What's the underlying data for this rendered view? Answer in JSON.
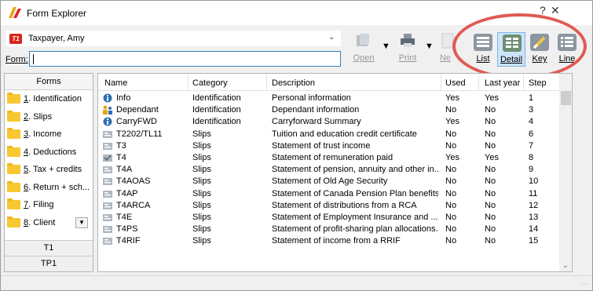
{
  "window": {
    "title": "Form Explorer",
    "help_glyph": "?",
    "close_glyph": "✕"
  },
  "taxpayer": {
    "name": "Taxpayer, Amy",
    "badge": "T1"
  },
  "form_field": {
    "label": "Form:",
    "value": ""
  },
  "toolbar": {
    "tools": [
      {
        "name": "open",
        "label": "Open",
        "icon": "open-icon",
        "enabled": false
      },
      {
        "name": "print",
        "label": "Print",
        "icon": "printer-icon",
        "enabled": false
      },
      {
        "name": "new",
        "label": "Ne",
        "icon": "new-form-icon",
        "enabled": false
      }
    ],
    "views": [
      {
        "name": "list",
        "label": "List",
        "icon": "list-view-icon",
        "active": false
      },
      {
        "name": "detail",
        "label": "Detail",
        "icon": "detail-view-icon",
        "active": true
      },
      {
        "name": "key",
        "label": "Key",
        "icon": "key-view-icon",
        "active": false
      },
      {
        "name": "line",
        "label": "Line",
        "icon": "line-view-icon",
        "active": false
      }
    ]
  },
  "sidebar": {
    "header": "Forms",
    "items": [
      {
        "num": "1",
        "text": ". Identification"
      },
      {
        "num": "2",
        "text": ". Slips"
      },
      {
        "num": "3",
        "text": ". Income"
      },
      {
        "num": "4",
        "text": ". Deductions"
      },
      {
        "num": "5",
        "text": ". Tax + credits"
      },
      {
        "num": "6",
        "text": ". Return + sch..."
      },
      {
        "num": "7",
        "text": ". Filing"
      },
      {
        "num": "8",
        "text": ". Client"
      }
    ],
    "tabs": [
      "T1",
      "TP1"
    ]
  },
  "table": {
    "columns": [
      "Name",
      "Category",
      "Description",
      "Used",
      "Last year",
      "Step"
    ],
    "rows": [
      {
        "icon": "info-icon",
        "name": "Info",
        "category": "Identification",
        "description": "Personal information",
        "used": "Yes",
        "last_year": "Yes",
        "step": "1"
      },
      {
        "icon": "people-icon",
        "name": "Dependant",
        "category": "Identification",
        "description": "Dependant information",
        "used": "No",
        "last_year": "No",
        "step": "3"
      },
      {
        "icon": "info-icon",
        "name": "CarryFWD",
        "category": "Identification",
        "description": "Carryforward Summary",
        "used": "Yes",
        "last_year": "No",
        "step": "4"
      },
      {
        "icon": "slip-icon",
        "name": "T2202/TL11",
        "category": "Slips",
        "description": "Tuition and education credit certificate",
        "used": "No",
        "last_year": "No",
        "step": "6"
      },
      {
        "icon": "slip-icon",
        "name": "T3",
        "category": "Slips",
        "description": "Statement of trust income",
        "used": "No",
        "last_year": "No",
        "step": "7"
      },
      {
        "icon": "slip-check-icon",
        "name": "T4",
        "category": "Slips",
        "description": "Statement of remuneration paid",
        "used": "Yes",
        "last_year": "Yes",
        "step": "8"
      },
      {
        "icon": "slip-icon",
        "name": "T4A",
        "category": "Slips",
        "description": "Statement of pension, annuity and other in...",
        "used": "No",
        "last_year": "No",
        "step": "9"
      },
      {
        "icon": "slip-icon",
        "name": "T4AOAS",
        "category": "Slips",
        "description": "Statement of Old Age Security",
        "used": "No",
        "last_year": "No",
        "step": "10"
      },
      {
        "icon": "slip-icon",
        "name": "T4AP",
        "category": "Slips",
        "description": "Statement of Canada Pension Plan benefits",
        "used": "No",
        "last_year": "No",
        "step": "11"
      },
      {
        "icon": "slip-icon",
        "name": "T4ARCA",
        "category": "Slips",
        "description": "Statement of distributions from a RCA",
        "used": "No",
        "last_year": "No",
        "step": "12"
      },
      {
        "icon": "slip-icon",
        "name": "T4E",
        "category": "Slips",
        "description": "Statement of Employment Insurance and ...",
        "used": "No",
        "last_year": "No",
        "step": "13"
      },
      {
        "icon": "slip-icon",
        "name": "T4PS",
        "category": "Slips",
        "description": "Statement of profit-sharing plan allocations...",
        "used": "No",
        "last_year": "No",
        "step": "14"
      },
      {
        "icon": "slip-icon",
        "name": "T4RIF",
        "category": "Slips",
        "description": "Statement of income from a RRIF",
        "used": "No",
        "last_year": "No",
        "step": "15"
      }
    ]
  },
  "colors": {
    "highlight": "#e05a55",
    "folder": "#f8c830",
    "active_view": "#cce4f7",
    "badge": "#d8271c"
  }
}
